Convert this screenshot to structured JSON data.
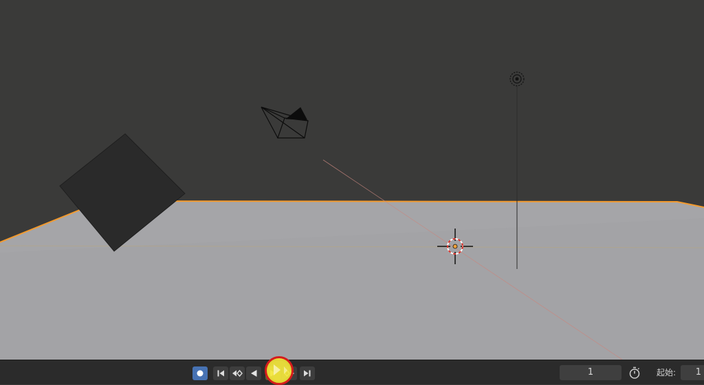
{
  "timeline": {
    "current_frame": "1",
    "start_label": "起始:",
    "start_frame": "1"
  },
  "icons": {
    "record": "record-icon",
    "jump_start": "jump-to-start-icon",
    "jump_keyframe_back": "jump-to-keyframe-back-icon",
    "play_reverse": "play-reverse-icon",
    "play": "play-icon",
    "jump_keyframe_forward": "jump-to-keyframe-forward-icon",
    "jump_end": "jump-to-end-icon",
    "stopwatch": "stopwatch-icon"
  },
  "colors": {
    "viewport_background": "#3a3a39",
    "ground_plane": "#a3a3a6",
    "selection_outline": "#f29a2e",
    "record_button": "#4772b3",
    "play_highlight": "#f5e83c",
    "play_highlight_ring": "#d51c1c"
  }
}
